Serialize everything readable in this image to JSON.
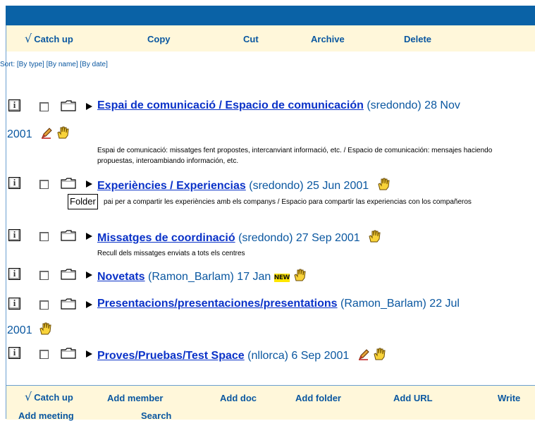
{
  "toolbar": {
    "catch_up": "Catch up",
    "copy": "Copy",
    "cut": "Cut",
    "archive": "Archive",
    "delete": "Delete"
  },
  "sort": {
    "label": "Sort:",
    "by_type": "[By type]",
    "by_name": "[By name]",
    "by_date": "[By date]"
  },
  "items": [
    {
      "title": "Espai de comunicació / Espacio de comunicación",
      "meta": "(sredondo) 28 Nov",
      "meta_cont": "2001",
      "description": "Espai de comunicació: missatges fent propostes, intercanviant informació, etc. / Espacio de comunicación: mensajes haciendo propuestas, interoambiando información, etc."
    },
    {
      "title": "Experiències / Experiencias",
      "meta": "(sredondo) 25 Jun 2001",
      "description": "pai per a compartir les experiències amb els companys / Espacio para compartir las experiencias con los compañeros"
    },
    {
      "title": "Missatges de coordinació",
      "meta": "(sredondo) 27 Sep 2001",
      "description": "Recull dels missatges enviats a tots els centres"
    },
    {
      "title": "Novetats",
      "meta": "(Ramon_Barlam) 17 Jan",
      "badge": "NEW"
    },
    {
      "title": "Presentacions/presentaciones/presentations",
      "meta": "(Ramon_Barlam) 22 Jul",
      "meta_cont": "2001"
    },
    {
      "title": "Proves/Pruebas/Test Space",
      "meta": "(nllorca) 6 Sep 2001"
    }
  ],
  "tooltip": "Folder",
  "bottom": {
    "catch_up": "Catch up",
    "add_member": "Add member",
    "add_doc": "Add doc",
    "add_folder": "Add folder",
    "add_url": "Add URL",
    "write": "Write",
    "add_meeting": "Add meeting",
    "search": "Search"
  },
  "icons": {
    "info": "info-icon",
    "checkbox": "checkbox",
    "folder": "folder-icon",
    "expand": "triangle-right-icon",
    "hand": "hand-icon",
    "pen": "pen-icon"
  },
  "colors": {
    "header_blue": "#0a62a6",
    "toolbar_bg": "#fff7da",
    "link_blue": "#0a32c8",
    "text_blue": "#0a57a0"
  }
}
